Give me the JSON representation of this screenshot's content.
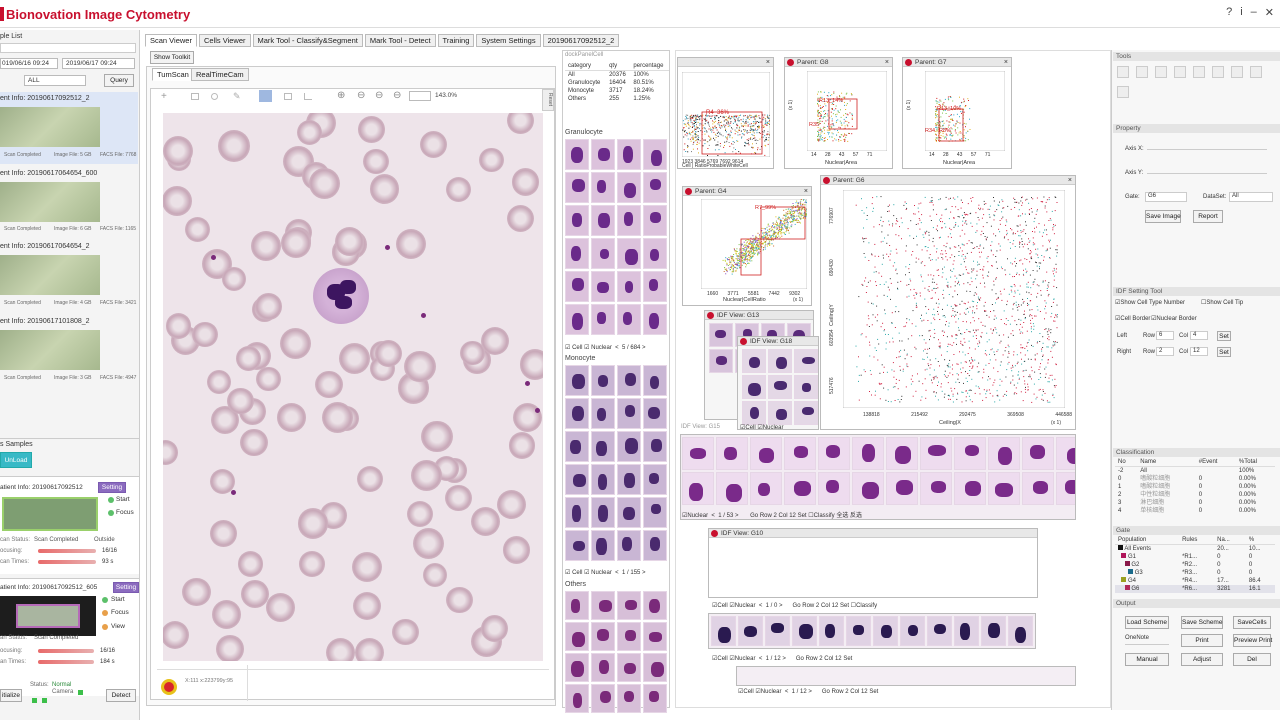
{
  "app": {
    "title": "Bionovation Image Cytometry"
  },
  "window_icons": [
    "?",
    "i",
    "–",
    "✕"
  ],
  "left": {
    "sample_list_label": "ple List",
    "date_from": "019/06/16 09:24",
    "date_to": "2019/06/17 09:24",
    "filter_all": "ALL",
    "query_label": "Query",
    "samples": [
      {
        "info": "ent Info: 20190617092512_2",
        "status": "Scan Completed",
        "file": "Image File: 5 GB",
        "facs": "FACS File: 7768"
      },
      {
        "info": "ent Info: 20190617064654_600",
        "status": "Scan Completed",
        "file": "Image File: 6 GB",
        "facs": "FACS File: 1165"
      },
      {
        "info": "ent Info: 20190617064654_2",
        "status": "Scan Completed",
        "file": "Image File: 4 GB",
        "facs": "FACS File: 3421"
      },
      {
        "info": "ent Info: 20190617101808_2",
        "status": "Scan Completed",
        "file": "Image File: 3 GB",
        "facs": "FACS File: 4947"
      }
    ],
    "samples_label": "s Samples",
    "unload_label": "UnLoad",
    "p1_info": "atient Info: 20190617092512",
    "p1_setting": "Setting",
    "p1_start": "Start",
    "p1_focus": "Focus",
    "p1_outside": "Outside",
    "p1_scan_status_label": "can Status:",
    "p1_scan_status": "Scan Completed",
    "p1_focusing_label": "ocusing:",
    "p1_focusing": "16/16",
    "p1_focusing_progress": 1.0,
    "p1_times_label": "can Times:",
    "p1_times": "93 s",
    "p1_times_progress": 1.0,
    "p2_info": "atient Info: 20190617092512_605",
    "p2_setting": "Setting",
    "p2_start": "Start",
    "p2_focus": "Focus",
    "p2_view": "View",
    "p2_scan_status_label": "an Status:",
    "p2_scan_status": "Scan Completed",
    "p2_focusing_label": "ocusing:",
    "p2_focusing": "16/16",
    "p2_focusing_progress": 1.0,
    "p2_times_label": "an Times:",
    "p2_times": "184 s",
    "p2_times_progress": 1.0,
    "initialize_label": "itialize",
    "status_label": "Status:",
    "status_value": "Normal",
    "camera_label": "Camera",
    "detect_label": "Detect"
  },
  "tabs": [
    "Scan Viewer",
    "Cells Viewer",
    "Mark Tool - Classify&Segment",
    "Mark Tool - Detect",
    "Training",
    "System Settings",
    "20190617092512_2"
  ],
  "viewer": {
    "show_toolkit": "Show Toolkit",
    "subtabs": [
      "TumScan",
      "RealTimeCam"
    ],
    "zoom": "143.0%",
    "coords": "X:111 x:223799y:95",
    "reset": "Reset"
  },
  "dock": {
    "title": "dockPanelCell",
    "headers": [
      "category",
      "qty",
      "percentage"
    ],
    "rows": [
      [
        "All",
        "20376",
        "100%"
      ],
      [
        "Granulocyte",
        "16404",
        "80.51%"
      ],
      [
        "Monocyte",
        "3717",
        "18.24%"
      ],
      [
        "Others",
        "255",
        "1.25%"
      ]
    ],
    "granulocyte_label": "Granulocyte",
    "monocyte_label": "Monocyte",
    "others_label": "Others",
    "cell_label": "Cell",
    "nuclear_label": "Nuclear",
    "gran_page": "5",
    "gran_total": "684",
    "mono_page": "1",
    "mono_total": "155"
  },
  "plots": {
    "p1": {
      "title": "",
      "xlabel": "Cell | RatioProbableWhiteCell",
      "xticks": [
        "1923",
        "3846",
        "5769",
        "7692",
        "9614"
      ],
      "region": "R4_36%"
    },
    "g8": {
      "title": "Parent:  G8",
      "xlabel": "Nuclear|Area",
      "yunit": "(x 1)",
      "xticks": [
        "14",
        "28",
        "43",
        "57",
        "71"
      ],
      "region1": "R13_14%",
      "region2": "R35"
    },
    "g7": {
      "title": "Parent:  G7",
      "xlabel": "Nuclear|Area",
      "yunit": "(x 1)",
      "xticks": [
        "14",
        "28",
        "43",
        "57",
        "71"
      ],
      "region1": "R13_10%",
      "region2": "R34",
      "region3": "R8%"
    },
    "g4": {
      "title": "Parent:  G4",
      "xlabel": "Nuclear|CellRatio",
      "xunit": "(x 1)",
      "xticks": [
        "1660",
        "3771",
        "5581",
        "7442",
        "9302"
      ],
      "region": "R7_99%"
    },
    "g6": {
      "title": "Parent:  G6",
      "xlabel": "Ceiling|X",
      "ylabel": "Ceiling|Y",
      "xunit": "(x 1)",
      "xticks": [
        "138818",
        "215492",
        "292475",
        "369508",
        "446588"
      ],
      "yticks": [
        "517476",
        "603954",
        "690430",
        "776907"
      ]
    }
  },
  "idf": {
    "g13_title": "IDF View:  G13",
    "g18_title": "IDF View:  G18",
    "g15_title": "IDF View:  G15",
    "g10_title": "IDF View:  G10",
    "page1": "1",
    "total1": "53",
    "page2": "1",
    "total2": "0",
    "page3": "1",
    "total3": "12",
    "go": "Go",
    "row": "Row",
    "row_val": "2",
    "col": "Col",
    "col_val": "12",
    "set": "Set",
    "classify": "Classify",
    "nav1": "全选",
    "nav2": "反选"
  },
  "right": {
    "tools_label": "Tools",
    "property_label": "Property",
    "axis_x": "Axis X:",
    "axis_y": "Axis Y:",
    "gate_label": "Gate:",
    "gate_val": "G6",
    "dataset_label": "DataSet:",
    "dataset_val": "All",
    "save_image": "Save Image",
    "report": "Report",
    "idf_setting": "IDF Setting Tool",
    "show_cell_type": "Show Cell Type Number",
    "show_cell_tip": "Show Cell Tip",
    "cell_border": "Cell Border",
    "nuclear_border": "Nuclear Border",
    "left_label": "Left",
    "right_label": "Right",
    "row_label": "Row",
    "col_label": "Col",
    "left_row": "6",
    "left_col": "4",
    "right_row": "2",
    "right_col": "12",
    "set": "Set",
    "classification_label": "Classification",
    "class_headers": [
      "No",
      "Name",
      "#Event",
      "%Total"
    ],
    "class_rows": [
      [
        "-2",
        "All",
        "",
        "100%"
      ],
      [
        "0",
        "嗜酸粒细胞",
        "0",
        "0.00%"
      ],
      [
        "1",
        "嗜酸粒细胞",
        "0",
        "0.00%"
      ],
      [
        "2",
        "中性粒细胞",
        "0",
        "0.00%"
      ],
      [
        "3",
        "淋巴细胞",
        "0",
        "0.00%"
      ],
      [
        "4",
        "单核细胞",
        "0",
        "0.00%"
      ]
    ],
    "gate_section_label": "Gate",
    "gate_headers": [
      "Population",
      "Rules",
      "Na...",
      "%"
    ],
    "gate_rows": [
      [
        "All Events",
        "",
        "20...",
        "10..."
      ],
      [
        "G1",
        "*R1...",
        "0",
        "0"
      ],
      [
        "G2",
        "*R2...",
        "0",
        "0"
      ],
      [
        "G3",
        "*R3...",
        "0",
        "0"
      ],
      [
        "G4",
        "*R4...",
        "17...",
        "86.4"
      ],
      [
        "G6",
        "*R6...",
        "3281",
        "16.1"
      ]
    ],
    "output_label": "Output",
    "load_scheme": "Load Scheme",
    "save_scheme": "Save Scheme",
    "save_cells": "SaveCells",
    "onenote": "OneNote",
    "print": "Print",
    "preview_print": "Preview Print",
    "manual": "Manual",
    "adjust": "Adjust",
    "del": "Del"
  }
}
